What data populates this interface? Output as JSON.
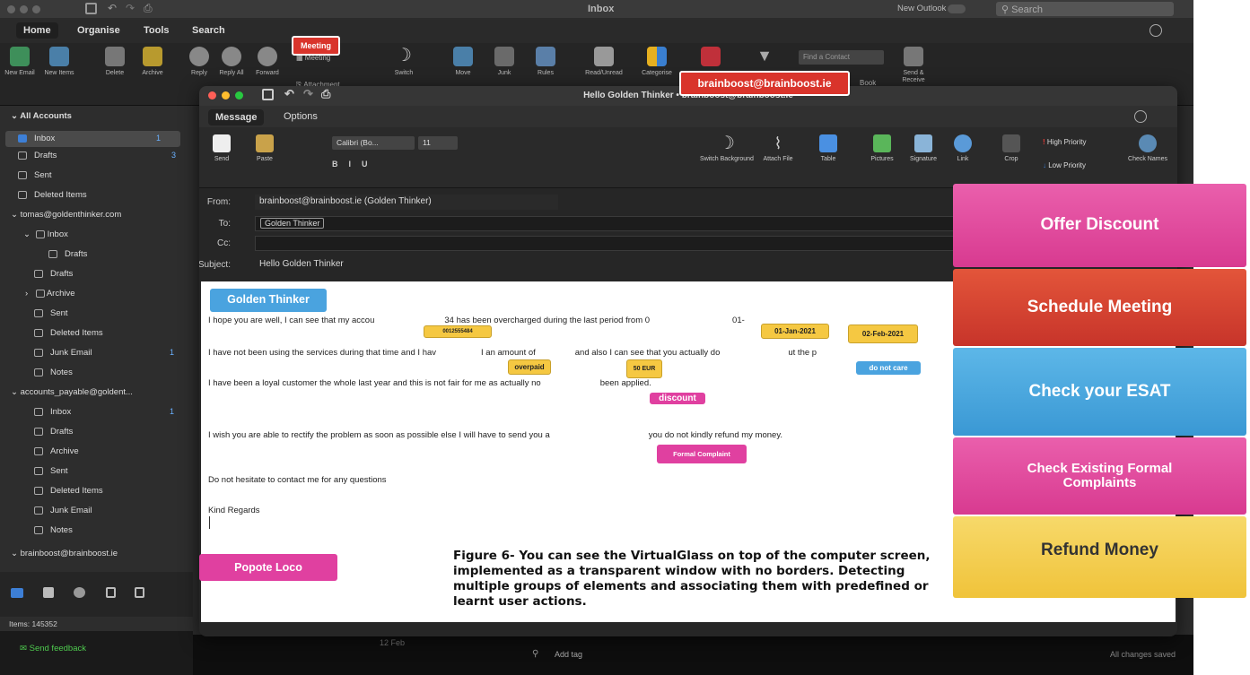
{
  "titlebar": {
    "title": "Inbox",
    "new_outlook": "New Outlook",
    "search_placeholder": "Search"
  },
  "main_tabs": [
    "Home",
    "Organise",
    "Tools",
    "Search"
  ],
  "ribbon": {
    "new_email": "New Email",
    "new_items": "New Items",
    "delete": "Delete",
    "archive": "Archive",
    "reply": "Reply",
    "reply_all": "Reply All",
    "forward": "Forward",
    "meeting": "Meeting",
    "attachment": "Attachment",
    "switch": "Switch",
    "move": "Move",
    "junk": "Junk",
    "rules": "Rules",
    "read_unread": "Read/Unread",
    "categorise": "Categorise",
    "find_contact_placeholder": "Find a Contact",
    "address_book": "Book",
    "send_receive": "Send & Receive"
  },
  "sidebar": {
    "all_accounts": "All Accounts",
    "inbox": "Inbox",
    "inbox_count": "1",
    "drafts": "Drafts",
    "drafts_count": "3",
    "sent": "Sent",
    "deleted": "Deleted Items",
    "account2": "tomas@goldenthinker.com",
    "a2_inbox": "Inbox",
    "a2_drafts_sub": "Drafts",
    "a2_drafts": "Drafts",
    "a2_archive": "Archive",
    "a2_sent": "Sent",
    "a2_deleted": "Deleted Items",
    "a2_junk": "Junk Email",
    "a2_junk_count": "1",
    "a2_notes": "Notes",
    "account3": "accounts_payable@goldent...",
    "a3_inbox": "Inbox",
    "a3_inbox_count": "1",
    "a3_drafts": "Drafts",
    "a3_archive": "Archive",
    "a3_sent": "Sent",
    "a3_deleted": "Deleted Items",
    "a3_junk": "Junk Email",
    "a3_notes": "Notes",
    "account4": "brainboost@brainboost.ie"
  },
  "status": {
    "items": "Items: 145352",
    "feedback": "Send feedback",
    "date": "12 Feb",
    "add_tag": "Add tag",
    "saved": "All changes saved"
  },
  "compose": {
    "title": "Hello Golden Thinker • brainboost@brainboost.ie",
    "tabs": [
      "Message",
      "Options"
    ],
    "send": "Send",
    "paste": "Paste",
    "font": "Calibri (Bo...",
    "size": "11",
    "switch_bg": "Switch Background",
    "attach": "Attach File",
    "table": "Table",
    "pictures": "Pictures",
    "signature": "Signature",
    "link": "Link",
    "crop": "Crop",
    "high_priority": "High Priority",
    "low_priority": "Low Priority",
    "check_names": "Check Names",
    "from_label": "From:",
    "from": "brainboost@brainboost.ie (Golden Thinker)",
    "to_label": "To:",
    "to": "Golden Thinker",
    "cc_label": "Cc:",
    "subject_label": "Subject:",
    "subject": "Hello Golden Thinker"
  },
  "email": {
    "l1a": "I hope you are well, I can see that my accou",
    "l1b": "34 has been overcharged during the last period from 0",
    "l1c": "01-",
    "l2a": "I have not been using the services during that time and I hav",
    "l2b": "I an amount of",
    "l2c": "and also I can see that you actually do",
    "l2d": "ut the p",
    "l3a": "I have been a loyal customer the whole last year and this is not fair for me as actually no",
    "l3b": "been applied.",
    "l4a": "I wish you are able to rectify the problem as soon as possible else I will have to send you a",
    "l4b": "you do not kindly refund my money.",
    "l5": "Do not hesitate to contact me for any questions",
    "l6": "Kind Regards"
  },
  "tags": {
    "golden_thinker": "Golden Thinker",
    "account_no": "0012555484",
    "date1": "01-Jan-2021",
    "date2": "02-Feb-2021",
    "overpaid": "overpaid",
    "amount": "50 EUR",
    "do_not_care": "do not care",
    "discount": "discount",
    "formal_complaint": "Formal Complaint",
    "popote": "Popote Loco",
    "meeting": "Meeting",
    "email_addr": "brainboost@brainboost.ie"
  },
  "actions": [
    "Offer Discount",
    "Schedule Meeting",
    "Check your ESAT",
    "Check Existing Formal Complaints",
    "Refund Money"
  ],
  "caption": "Figure 6- You can see the VirtualGlass on top of the computer screen, implemented as a transparent window with no borders.  Detecting multiple groups of elements and associating them with predefined or learnt user actions."
}
